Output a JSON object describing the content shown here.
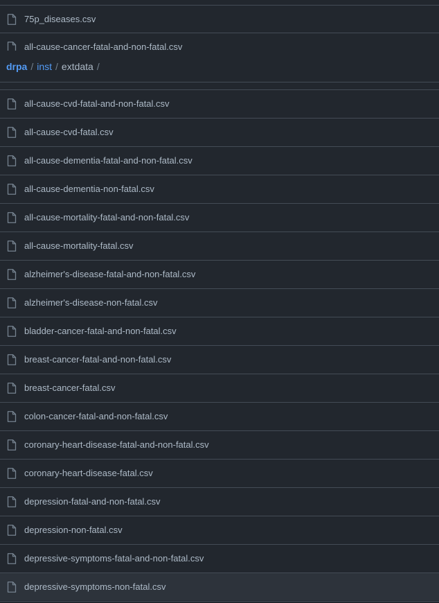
{
  "breadcrumb": {
    "repo": "drpa",
    "separator": "/",
    "folder": "inst",
    "current": "extdata",
    "trailing": "/"
  },
  "files_above": [
    {
      "name": "75p_diseases.csv",
      "icon": "file-icon"
    },
    {
      "name": "all-cause-cancer-fatal-and-non-fatal.csv",
      "icon": "file-icon"
    }
  ],
  "files": [
    {
      "name": "all-cause-cvd-fatal-and-non-fatal.csv",
      "icon": "file-icon"
    },
    {
      "name": "all-cause-cvd-fatal.csv",
      "icon": "file-icon"
    },
    {
      "name": "all-cause-dementia-fatal-and-non-fatal.csv",
      "icon": "file-icon"
    },
    {
      "name": "all-cause-dementia-non-fatal.csv",
      "icon": "file-icon"
    },
    {
      "name": "all-cause-mortality-fatal-and-non-fatal.csv",
      "icon": "file-icon"
    },
    {
      "name": "all-cause-mortality-fatal.csv",
      "icon": "file-icon"
    },
    {
      "name": "alzheimer's-disease-fatal-and-non-fatal.csv",
      "icon": "file-icon"
    },
    {
      "name": "alzheimer's-disease-non-fatal.csv",
      "icon": "file-icon"
    },
    {
      "name": "bladder-cancer-fatal-and-non-fatal.csv",
      "icon": "file-icon"
    },
    {
      "name": "breast-cancer-fatal-and-non-fatal.csv",
      "icon": "file-icon"
    },
    {
      "name": "breast-cancer-fatal.csv",
      "icon": "file-icon"
    },
    {
      "name": "colon-cancer-fatal-and-non-fatal.csv",
      "icon": "file-icon"
    },
    {
      "name": "coronary-heart-disease-fatal-and-non-fatal.csv",
      "icon": "file-icon"
    },
    {
      "name": "coronary-heart-disease-fatal.csv",
      "icon": "file-icon"
    },
    {
      "name": "depression-fatal-and-non-fatal.csv",
      "icon": "file-icon"
    },
    {
      "name": "depression-non-fatal.csv",
      "icon": "file-icon"
    },
    {
      "name": "depressive-symptoms-fatal-and-non-fatal.csv",
      "icon": "file-icon"
    },
    {
      "name": "depressive-symptoms-non-fatal.csv",
      "icon": "file-icon"
    }
  ],
  "colors": {
    "background": "#22272e",
    "border": "#444c56",
    "text": "#adbac7",
    "link": "#539bf5",
    "muted": "#768390",
    "hover_row": "#2d333b"
  }
}
